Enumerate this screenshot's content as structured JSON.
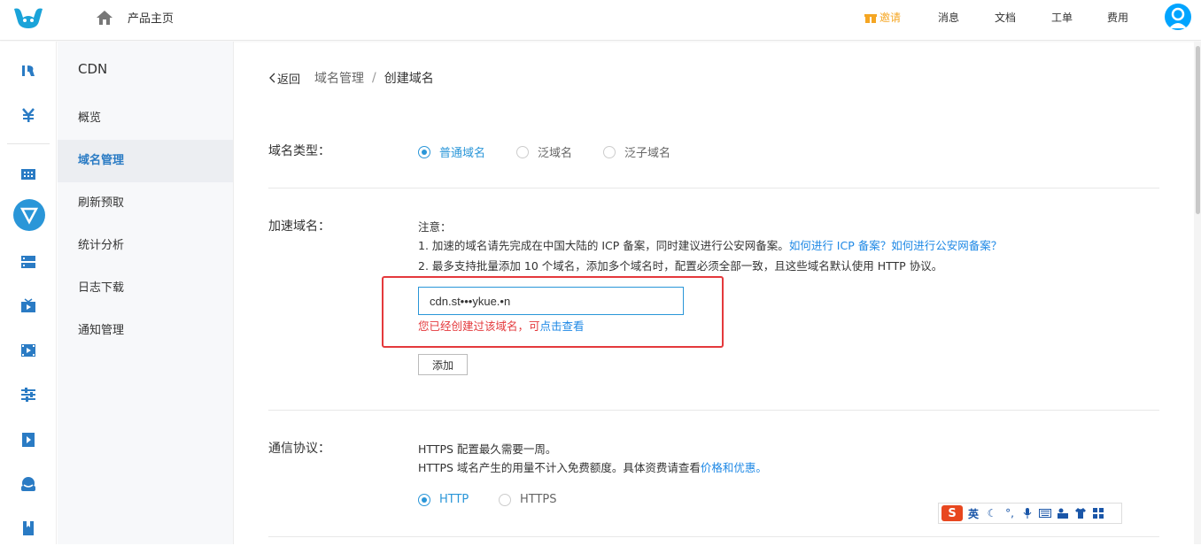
{
  "topbar": {
    "home_label": "产品主页",
    "nav": {
      "invite": "邀请",
      "messages": "消息",
      "docs": "文档",
      "tickets": "工单",
      "billing": "费用"
    }
  },
  "rail_icons": [
    "qcloud-icon",
    "yuan-icon",
    "grid-icon",
    "cdn-icon",
    "server-icon",
    "tv-icon",
    "film-icon",
    "sliders-icon",
    "play-icon",
    "cloud-user-icon",
    "bookmark-icon"
  ],
  "sidebar": {
    "title": "CDN",
    "items": [
      {
        "label": "概览",
        "active": false
      },
      {
        "label": "域名管理",
        "active": true
      },
      {
        "label": "刷新预取",
        "active": false
      },
      {
        "label": "统计分析",
        "active": false
      },
      {
        "label": "日志下载",
        "active": false
      },
      {
        "label": "通知管理",
        "active": false
      }
    ]
  },
  "breadcrumb": {
    "back": "返回",
    "parent": "域名管理",
    "separator": "/",
    "current": "创建域名"
  },
  "domain_type": {
    "label": "域名类型：",
    "options": [
      {
        "label": "普通域名",
        "selected": true
      },
      {
        "label": "泛域名",
        "selected": false
      },
      {
        "label": "泛子域名",
        "selected": false
      }
    ]
  },
  "accel_domain": {
    "label": "加速域名：",
    "note_title": "注意：",
    "note1_text": "1. 加速的域名请先完成在中国大陆的 ICP 备案，同时建议进行公安网备案。",
    "note1_link": "如何进行 ICP 备案？如何进行公安网备案？",
    "note2_text": "2. 最多支持批量添加 10 个域名，添加多个域名时，配置必须全部一致，且这些域名默认使用 HTTP 协议。",
    "input_value": "cdn.st•••ykue.•n",
    "error_text": "您已经创建过该域名，可",
    "error_link": "点击查看",
    "add_button": "添加"
  },
  "protocol": {
    "label": "通信协议：",
    "line1": "HTTPS 配置最久需要一周。",
    "line2_text": "HTTPS 域名产生的用量不计入免费额度。具体资费请查看",
    "line2_link": "价格和优惠。",
    "options": [
      {
        "label": "HTTP",
        "selected": true
      },
      {
        "label": "HTTPS",
        "selected": false
      }
    ]
  },
  "ime": {
    "logo": "S",
    "mode": "英"
  },
  "colors": {
    "accent": "#2a96d8",
    "link": "#1e88e5",
    "error": "#e4393c",
    "invite": "#f5a623"
  }
}
